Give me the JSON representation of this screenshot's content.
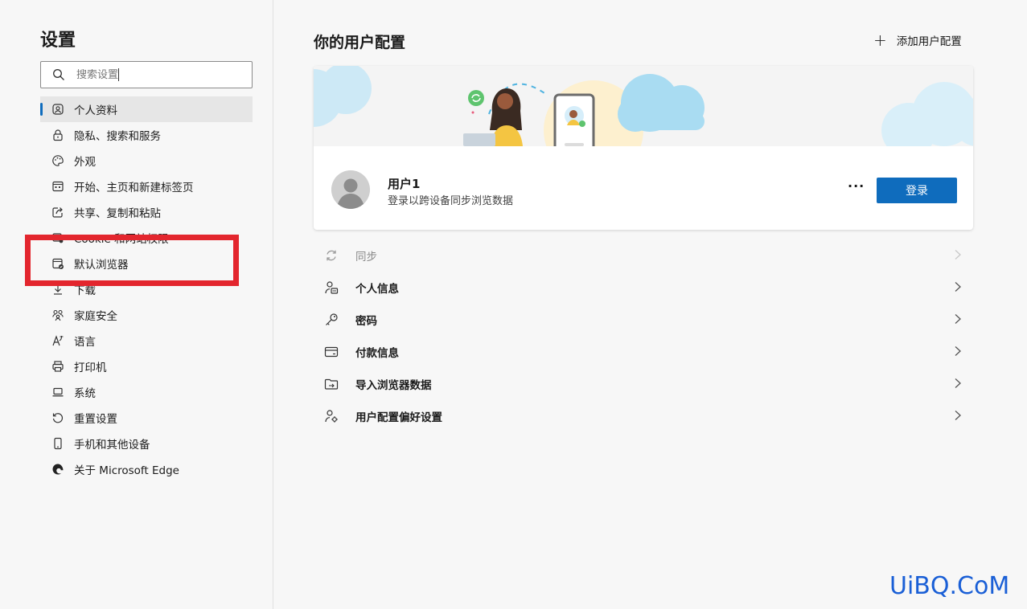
{
  "sidebar": {
    "title": "设置",
    "search_placeholder": "搜索设置",
    "items": [
      {
        "label": "个人资料",
        "icon": "profile-icon",
        "active": true
      },
      {
        "label": "隐私、搜索和服务",
        "icon": "lock-icon"
      },
      {
        "label": "外观",
        "icon": "palette-icon"
      },
      {
        "label": "开始、主页和新建标签页",
        "icon": "home-window-icon"
      },
      {
        "label": "共享、复制和粘贴",
        "icon": "share-icon"
      },
      {
        "label": "Cookie 和网站权限",
        "icon": "cookie-settings-icon"
      },
      {
        "label": "默认浏览器",
        "icon": "default-browser-icon"
      },
      {
        "label": "下载",
        "icon": "download-icon"
      },
      {
        "label": "家庭安全",
        "icon": "family-icon"
      },
      {
        "label": "语言",
        "icon": "language-icon"
      },
      {
        "label": "打印机",
        "icon": "printer-icon"
      },
      {
        "label": "系统",
        "icon": "laptop-icon"
      },
      {
        "label": "重置设置",
        "icon": "reset-icon"
      },
      {
        "label": "手机和其他设备",
        "icon": "phone-icon"
      },
      {
        "label": "关于 Microsoft Edge",
        "icon": "edge-logo-icon"
      }
    ]
  },
  "main": {
    "title": "你的用户配置",
    "add_profile_label": "添加用户配置",
    "profile": {
      "name": "用户1",
      "subtitle": "登录以跨设备同步浏览数据",
      "more_label": "···",
      "login_label": "登录"
    },
    "settings": [
      {
        "label": "同步",
        "icon": "sync-icon",
        "disabled": true
      },
      {
        "label": "个人信息",
        "icon": "person-card-icon"
      },
      {
        "label": "密码",
        "icon": "key-icon"
      },
      {
        "label": "付款信息",
        "icon": "credit-card-icon"
      },
      {
        "label": "导入浏览器数据",
        "icon": "import-folder-icon"
      },
      {
        "label": "用户配置偏好设置",
        "icon": "person-settings-icon"
      }
    ]
  },
  "watermark": "UiBQ.CoM",
  "colors": {
    "accent": "#0f6cbd",
    "highlight_box": "#e3262e",
    "watermark": "#1a5fd6"
  }
}
